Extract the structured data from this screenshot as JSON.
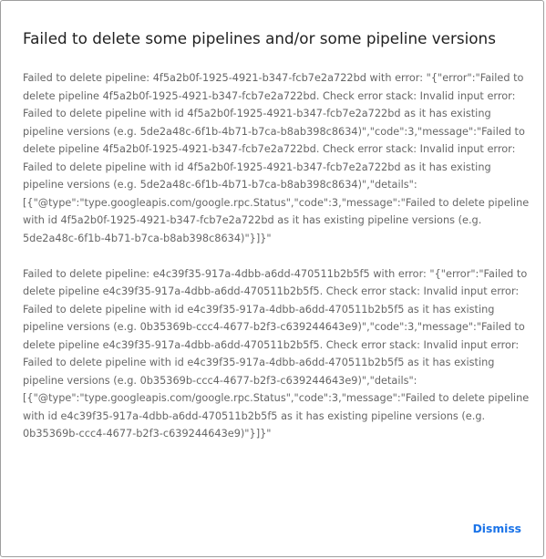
{
  "dialog": {
    "title": "Failed to delete some pipelines and/or some pipeline versions",
    "messages": [
      "Failed to delete pipeline: 4f5a2b0f-1925-4921-b347-fcb7e2a722bd with error: \"{\"error\":\"Failed to delete pipeline 4f5a2b0f-1925-4921-b347-fcb7e2a722bd. Check error stack: Invalid input error: Failed to delete pipeline with id 4f5a2b0f-1925-4921-b347-fcb7e2a722bd as it has existing pipeline versions (e.g. 5de2a48c-6f1b-4b71-b7ca-b8ab398c8634)\",\"code\":3,\"message\":\"Failed to delete pipeline 4f5a2b0f-1925-4921-b347-fcb7e2a722bd. Check error stack: Invalid input error: Failed to delete pipeline with id 4f5a2b0f-1925-4921-b347-fcb7e2a722bd as it has existing pipeline versions (e.g. 5de2a48c-6f1b-4b71-b7ca-b8ab398c8634)\",\"details\":[{\"@type\":\"type.googleapis.com/google.rpc.Status\",\"code\":3,\"message\":\"Failed to delete pipeline with id 4f5a2b0f-1925-4921-b347-fcb7e2a722bd as it has existing pipeline versions (e.g. 5de2a48c-6f1b-4b71-b7ca-b8ab398c8634)\"}]}\"",
      "Failed to delete pipeline: e4c39f35-917a-4dbb-a6dd-470511b2b5f5 with error: \"{\"error\":\"Failed to delete pipeline e4c39f35-917a-4dbb-a6dd-470511b2b5f5. Check error stack: Invalid input error: Failed to delete pipeline with id e4c39f35-917a-4dbb-a6dd-470511b2b5f5 as it has existing pipeline versions (e.g. 0b35369b-ccc4-4677-b2f3-c639244643e9)\",\"code\":3,\"message\":\"Failed to delete pipeline e4c39f35-917a-4dbb-a6dd-470511b2b5f5. Check error stack: Invalid input error: Failed to delete pipeline with id e4c39f35-917a-4dbb-a6dd-470511b2b5f5 as it has existing pipeline versions (e.g. 0b35369b-ccc4-4677-b2f3-c639244643e9)\",\"details\":[{\"@type\":\"type.googleapis.com/google.rpc.Status\",\"code\":3,\"message\":\"Failed to delete pipeline with id e4c39f35-917a-4dbb-a6dd-470511b2b5f5 as it has existing pipeline versions (e.g. 0b35369b-ccc4-4677-b2f3-c639244643e9)\"}]}\""
    ],
    "dismiss_label": "Dismiss"
  },
  "colors": {
    "title": "#212121",
    "body_text": "#666666",
    "accent": "#1a73e8",
    "border": "#9e9e9e"
  }
}
